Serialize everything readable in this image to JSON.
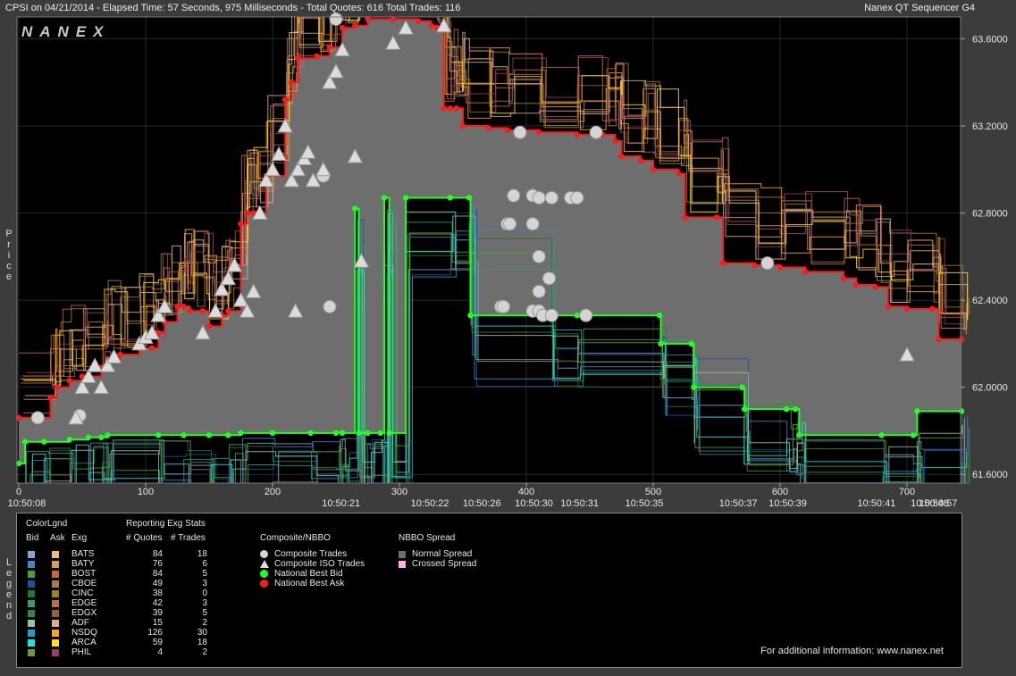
{
  "header": {
    "left": "CPSI on 04/21/2014  -  Elapsed Time: 57 Seconds, 975 Milliseconds  -  Total Quotes: 616  Total Trades: 116",
    "right": "Nanex QT Sequencer G4",
    "logo": "NANEX"
  },
  "axis_titles": {
    "price_vertical": "Price",
    "legend_vertical": "Legend"
  },
  "chart_data": {
    "type": "line",
    "title": "CPSI on 04/21/2014",
    "ylabel": "Price",
    "ylim": [
      61.56,
      63.7
    ],
    "xlim": [
      0,
      740
    ],
    "y_ticks": [
      "63.6000",
      "63.2000",
      "62.8000",
      "62.4000",
      "62.0000",
      "61.6000"
    ],
    "y_tick_values": [
      63.6,
      63.2,
      62.8,
      62.4,
      62.0,
      61.6
    ],
    "x_ticks": [
      "0",
      "100",
      "200",
      "300",
      "400",
      "500",
      "600",
      "700"
    ],
    "x_tick_values": [
      0,
      100,
      200,
      300,
      400,
      500,
      600,
      700
    ],
    "time_labels": [
      {
        "x": 0,
        "label": "10:50:08"
      },
      {
        "x": 254,
        "label": "10:50:21"
      },
      {
        "x": 324,
        "label": "10:50:22"
      },
      {
        "x": 365,
        "label": "10:50:26"
      },
      {
        "x": 406,
        "label": "10:50:30"
      },
      {
        "x": 442,
        "label": "10:50:31"
      },
      {
        "x": 493,
        "label": "10:50:35"
      },
      {
        "x": 567,
        "label": "10:50:37"
      },
      {
        "x": 606,
        "label": "10:50:39"
      },
      {
        "x": 676,
        "label": "10:50:41"
      },
      {
        "x": 718,
        "label": "10:50:48"
      },
      {
        "x": 743,
        "label": "10:50:57"
      }
    ],
    "series": [
      {
        "name": "National Best Ask",
        "color": "#ff1a1a",
        "points": [
          [
            0,
            61.86
          ],
          [
            25,
            61.95
          ],
          [
            30,
            62.0
          ],
          [
            40,
            62.03
          ],
          [
            50,
            62.05
          ],
          [
            65,
            62.09
          ],
          [
            70,
            62.13
          ],
          [
            80,
            62.15
          ],
          [
            95,
            62.18
          ],
          [
            105,
            62.18
          ],
          [
            110,
            62.25
          ],
          [
            115,
            62.3
          ],
          [
            125,
            62.37
          ],
          [
            130,
            62.37
          ],
          [
            135,
            62.35
          ],
          [
            145,
            62.35
          ],
          [
            150,
            62.28
          ],
          [
            160,
            62.33
          ],
          [
            165,
            62.35
          ],
          [
            175,
            62.75
          ],
          [
            180,
            62.8
          ],
          [
            185,
            62.8
          ],
          [
            195,
            62.97
          ],
          [
            210,
            63.32
          ],
          [
            215,
            63.4
          ],
          [
            220,
            63.51
          ],
          [
            235,
            63.52
          ],
          [
            245,
            63.56
          ],
          [
            255,
            63.65
          ],
          [
            265,
            63.66
          ],
          [
            275,
            63.69
          ],
          [
            295,
            63.69
          ],
          [
            315,
            63.68
          ],
          [
            325,
            63.66
          ],
          [
            330,
            63.65
          ],
          [
            335,
            63.28
          ],
          [
            340,
            63.28
          ],
          [
            345,
            63.28
          ],
          [
            350,
            63.2
          ],
          [
            370,
            63.19
          ],
          [
            385,
            63.18
          ],
          [
            410,
            63.17
          ],
          [
            440,
            63.16
          ],
          [
            460,
            63.16
          ],
          [
            470,
            63.13
          ],
          [
            475,
            63.06
          ],
          [
            490,
            63.04
          ],
          [
            500,
            63.0
          ],
          [
            520,
            62.98
          ],
          [
            525,
            62.78
          ],
          [
            550,
            62.78
          ],
          [
            555,
            62.57
          ],
          [
            580,
            62.56
          ],
          [
            600,
            62.55
          ],
          [
            620,
            62.53
          ],
          [
            650,
            62.5
          ],
          [
            660,
            62.47
          ],
          [
            675,
            62.46
          ],
          [
            685,
            62.37
          ],
          [
            700,
            62.36
          ],
          [
            720,
            62.36
          ],
          [
            725,
            62.22
          ],
          [
            743,
            62.22
          ]
        ]
      },
      {
        "name": "National Best Bid",
        "color": "#22ff22",
        "points": [
          [
            0,
            61.65
          ],
          [
            5,
            61.75
          ],
          [
            20,
            61.75
          ],
          [
            40,
            61.76
          ],
          [
            55,
            61.77
          ],
          [
            65,
            61.77
          ],
          [
            70,
            61.78
          ],
          [
            110,
            61.78
          ],
          [
            130,
            61.78
          ],
          [
            150,
            61.78
          ],
          [
            165,
            61.78
          ],
          [
            175,
            61.79
          ],
          [
            200,
            61.79
          ],
          [
            230,
            61.79
          ],
          [
            250,
            61.79
          ],
          [
            255,
            61.79
          ],
          [
            265,
            62.82
          ],
          [
            268,
            61.79
          ],
          [
            275,
            61.79
          ],
          [
            285,
            61.79
          ],
          [
            288,
            62.87
          ],
          [
            292,
            61.79
          ],
          [
            305,
            62.87
          ],
          [
            340,
            62.87
          ],
          [
            355,
            62.87
          ],
          [
            356,
            62.33
          ],
          [
            420,
            62.33
          ],
          [
            440,
            62.33
          ],
          [
            505,
            62.33
          ],
          [
            506,
            62.2
          ],
          [
            530,
            62.2
          ],
          [
            532,
            62.0
          ],
          [
            570,
            62.0
          ],
          [
            572,
            61.9
          ],
          [
            605,
            61.9
          ],
          [
            612,
            61.9
          ],
          [
            615,
            61.78
          ],
          [
            680,
            61.78
          ],
          [
            705,
            61.78
          ],
          [
            708,
            61.89
          ],
          [
            743,
            61.89
          ]
        ]
      },
      {
        "name": "Composite Trades",
        "color": "#d8d8d8",
        "points": [
          [
            15,
            61.86
          ],
          [
            48,
            61.87
          ],
          [
            240,
            62.97
          ],
          [
            245,
            62.37
          ],
          [
            250,
            63.69
          ],
          [
            390,
            62.88
          ],
          [
            405,
            62.88
          ],
          [
            410,
            62.87
          ],
          [
            420,
            62.87
          ],
          [
            435,
            62.87
          ],
          [
            440,
            62.87
          ],
          [
            395,
            63.17
          ],
          [
            455,
            63.17
          ],
          [
            385,
            62.75
          ],
          [
            387,
            62.75
          ],
          [
            405,
            62.75
          ],
          [
            410,
            62.6
          ],
          [
            410,
            62.44
          ],
          [
            418,
            62.5
          ],
          [
            380,
            62.37
          ],
          [
            382,
            62.37
          ],
          [
            405,
            62.35
          ],
          [
            410,
            62.35
          ],
          [
            413,
            62.33
          ],
          [
            420,
            62.33
          ],
          [
            447,
            62.33
          ],
          [
            590,
            62.57
          ]
        ]
      },
      {
        "name": "Composite ISO Trades",
        "color": "#d8d8d8",
        "points": [
          [
            45,
            61.86
          ],
          [
            50,
            62.0
          ],
          [
            55,
            62.05
          ],
          [
            60,
            62.1
          ],
          [
            65,
            62.0
          ],
          [
            70,
            62.1
          ],
          [
            75,
            62.14
          ],
          [
            95,
            62.2
          ],
          [
            100,
            62.23
          ],
          [
            105,
            62.25
          ],
          [
            110,
            62.33
          ],
          [
            115,
            62.37
          ],
          [
            145,
            62.25
          ],
          [
            155,
            62.35
          ],
          [
            160,
            62.45
          ],
          [
            165,
            62.5
          ],
          [
            170,
            62.56
          ],
          [
            175,
            62.4
          ],
          [
            180,
            62.35
          ],
          [
            185,
            62.44
          ],
          [
            190,
            62.8
          ],
          [
            195,
            62.95
          ],
          [
            200,
            63.0
          ],
          [
            205,
            63.07
          ],
          [
            210,
            63.2
          ],
          [
            215,
            62.95
          ],
          [
            220,
            63.0
          ],
          [
            225,
            63.05
          ],
          [
            228,
            63.08
          ],
          [
            232,
            62.95
          ],
          [
            240,
            63.0
          ],
          [
            245,
            63.4
          ],
          [
            250,
            63.45
          ],
          [
            255,
            63.55
          ],
          [
            265,
            63.06
          ],
          [
            270,
            62.58
          ],
          [
            295,
            63.58
          ],
          [
            305,
            63.65
          ],
          [
            335,
            63.66
          ],
          [
            700,
            62.15
          ],
          [
            218,
            62.35
          ]
        ]
      }
    ]
  },
  "legend": {
    "head_colorlgnd": "ColorLgnd",
    "head_bid": "Bid",
    "head_ask": "Ask",
    "head_exg": "Exg",
    "head_stats": "Reporting Exg Stats",
    "head_quotes": "# Quotes",
    "head_trades": "# Trades",
    "head_composite": "Composite/NBBO",
    "head_spread": "NBBO Spread",
    "rows": [
      {
        "exg": "BATS",
        "quotes": "84",
        "trades": "18",
        "bid": "#7fa7d9",
        "ask": "#f2b97a"
      },
      {
        "exg": "BATY",
        "quotes": "76",
        "trades": "6",
        "bid": "#4f7fbf",
        "ask": "#d39a6a"
      },
      {
        "exg": "BOST",
        "quotes": "84",
        "trades": "5",
        "bid": "#3aa63a",
        "ask": "#c46a3a"
      },
      {
        "exg": "CBOE",
        "quotes": "49",
        "trades": "3",
        "bid": "#1e4fa0",
        "ask": "#b0784a"
      },
      {
        "exg": "CINC",
        "quotes": "38",
        "trades": "0",
        "bid": "#1e7a1e",
        "ask": "#a08020"
      },
      {
        "exg": "EDGE",
        "quotes": "42",
        "trades": "3",
        "bid": "#3c9a6a",
        "ask": "#b57050"
      },
      {
        "exg": "EDGX",
        "quotes": "39",
        "trades": "5",
        "bid": "#2e8a4a",
        "ask": "#a35a3a"
      },
      {
        "exg": "ADF",
        "quotes": "15",
        "trades": "2",
        "bid": "#9fbf9f",
        "ask": "#d8b090"
      },
      {
        "exg": "NSDQ",
        "quotes": "126",
        "trades": "30",
        "bid": "#1e9ad8",
        "ask": "#ffa020"
      },
      {
        "exg": "ARCA",
        "quotes": "59",
        "trades": "18",
        "bid": "#20e0e0",
        "ask": "#ffe020"
      },
      {
        "exg": "PHIL",
        "quotes": "4",
        "trades": "2",
        "bid": "#6a9a3a",
        "ask": "#9a3a6a"
      }
    ],
    "composite_items": [
      {
        "label": "Composite Trades",
        "icon": "circle-icon"
      },
      {
        "label": "Composite ISO Trades",
        "icon": "triangle-icon"
      },
      {
        "label": "National Best Bid",
        "icon": "green-dot-icon"
      },
      {
        "label": "National Best Ask",
        "icon": "red-dot-icon"
      }
    ],
    "spread_items": [
      {
        "label": "Normal Spread",
        "color": "#6e6e6e"
      },
      {
        "label": "Crossed Spread",
        "color": "#ffb0e0"
      }
    ],
    "footer": "For additional information: www.nanex.net"
  }
}
